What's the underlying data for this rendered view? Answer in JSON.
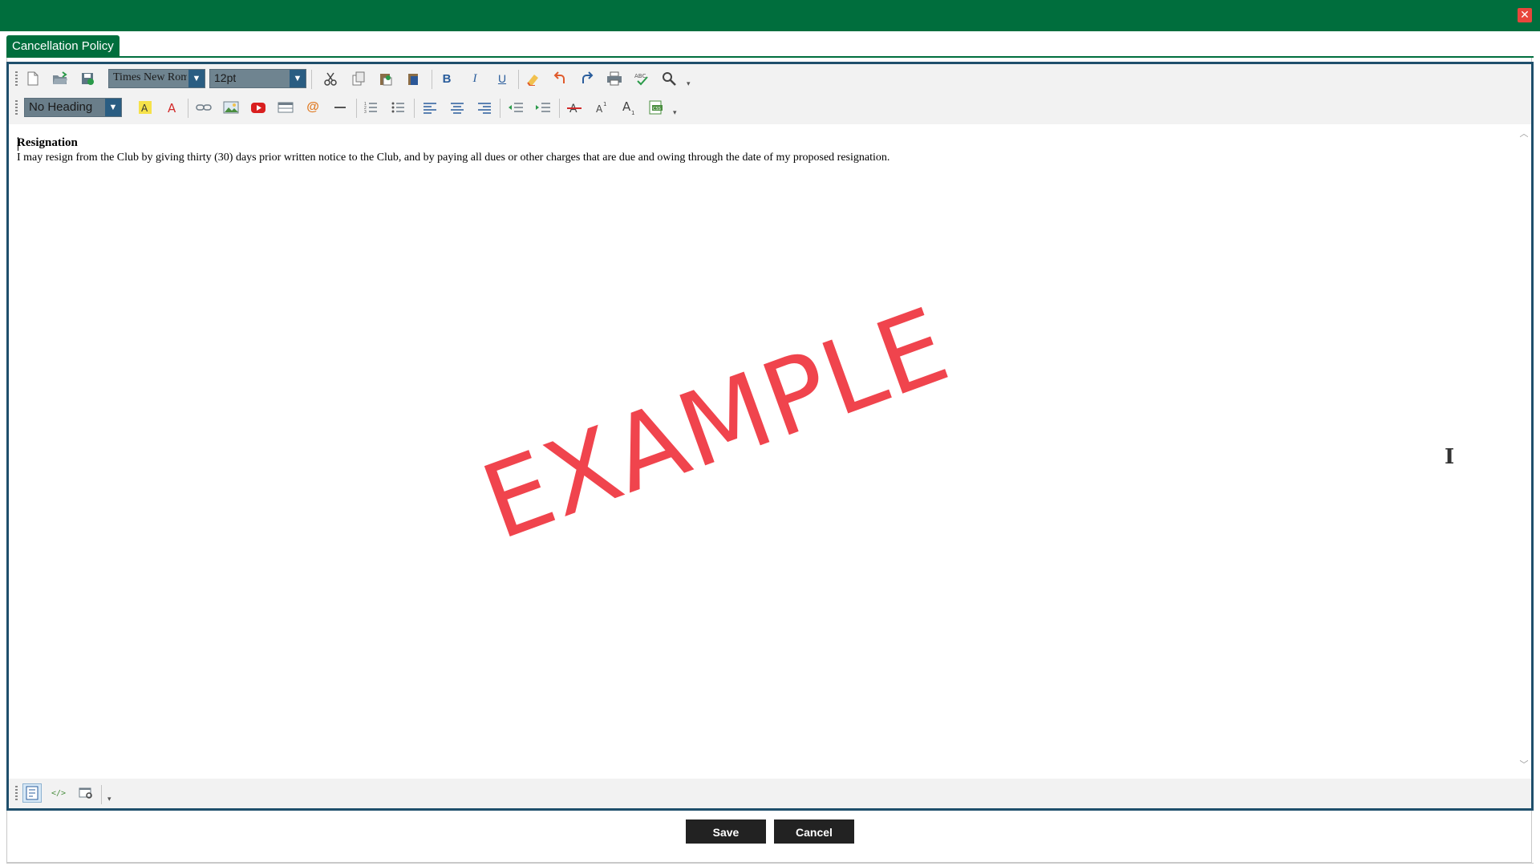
{
  "window": {
    "close_icon": "close-icon",
    "brand_color": "#006e3d"
  },
  "tab": {
    "label": "Cancellation Policy"
  },
  "toolbar": {
    "font_name": "Times New Roman",
    "font_size": "12pt",
    "heading": "No Heading",
    "bold_label": "B",
    "italic_label": "I",
    "underline_label": "U"
  },
  "document": {
    "heading": "Resignation",
    "body": "I may resign from the Club by giving thirty (30) days prior written notice to the Club, and by paying all dues or other charges that are due and owing through the date of my proposed resignation."
  },
  "watermark": {
    "text": "EXAMPLE",
    "color": "#f0444d"
  },
  "buttons": {
    "save": "Save",
    "cancel": "Cancel"
  }
}
